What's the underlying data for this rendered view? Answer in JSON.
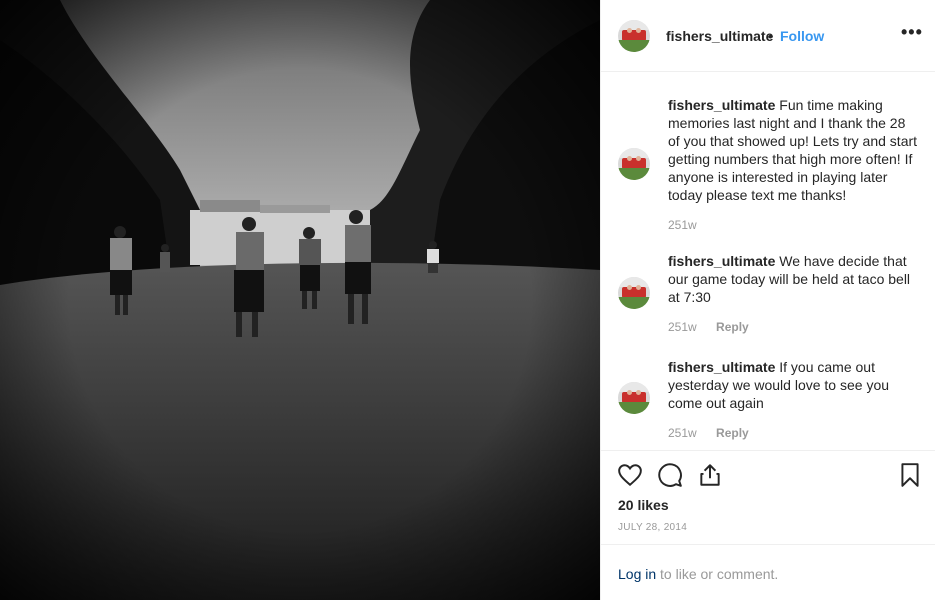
{
  "post": {
    "username": "fishers_ultimate",
    "dot": "•",
    "follow_label": "Follow",
    "more_label": "•••"
  },
  "comments": [
    {
      "username": "fishers_ultimate",
      "text": "Fun time making memories last night and I thank the 28 of you that showed up! Lets try and start getting numbers that high more often! If anyone is interested in playing later today please text me thanks!",
      "age": "251w",
      "reply": ""
    },
    {
      "username": "fishers_ultimate",
      "text": "We have decide that our game today will be held at taco bell at 7:30",
      "age": "251w",
      "reply": "Reply"
    },
    {
      "username": "fishers_ultimate",
      "text": "If you came out yesterday we would love to see you come out again",
      "age": "251w",
      "reply": "Reply"
    }
  ],
  "actions": {
    "like_icon": "heart-icon",
    "comment_icon": "comment-icon",
    "share_icon": "share-icon",
    "save_icon": "bookmark-icon"
  },
  "likes": "20 likes",
  "date": "JULY 28, 2014",
  "login": {
    "link": "Log in",
    "rest": " to like or comment."
  },
  "colors": {
    "follow": "#3897f0",
    "text": "#262626",
    "muted": "#999999",
    "link": "#003569"
  }
}
